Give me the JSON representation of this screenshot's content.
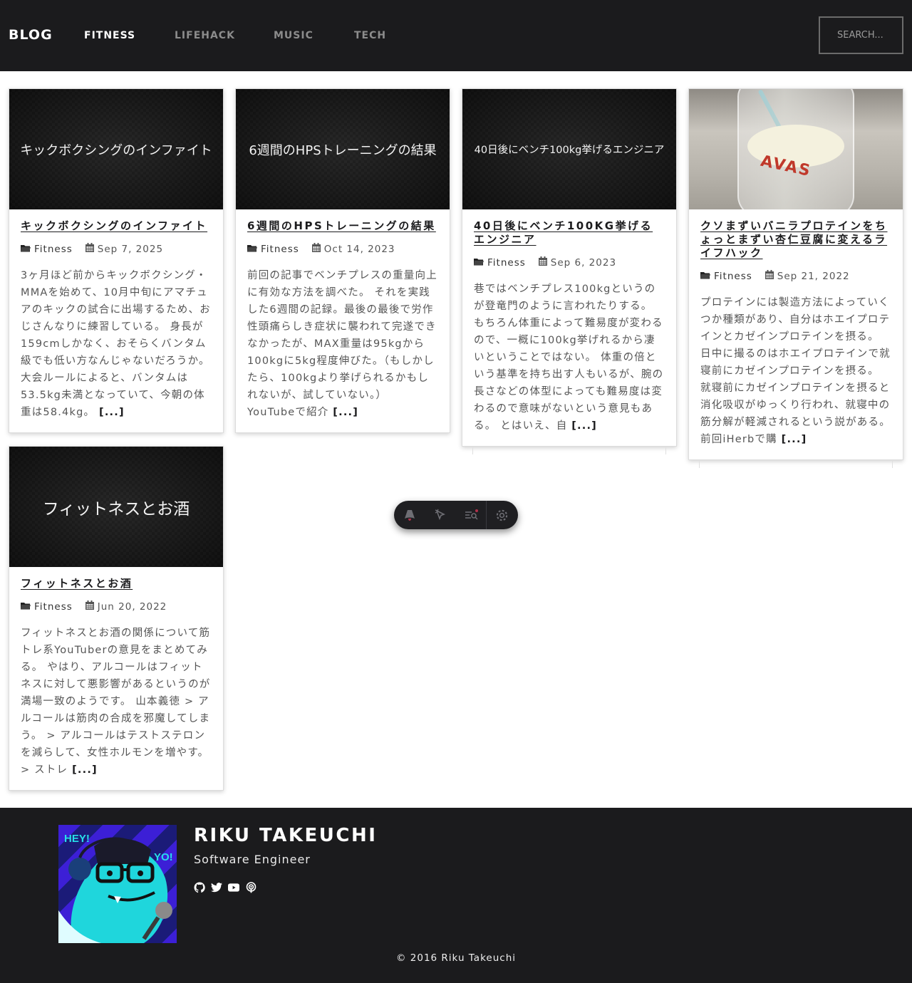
{
  "nav": {
    "brand": "BLOG",
    "links": [
      "FITNESS",
      "LIFEHACK",
      "MUSIC",
      "TECH"
    ],
    "search_placeholder": "SEARCH..."
  },
  "posts": [
    {
      "thumb_text": "キックボクシングのインファイト",
      "title": "キックボクシングのインファイト",
      "category": "Fitness",
      "date": "Sep 7, 2025",
      "excerpt": "3ヶ月ほど前からキックボクシング・MMAを始めて、10月中旬にアマチュアのキックの試合に出場するため、おじさんなりに練習している。 身長が159cmしかなく、おそらくバンタム級でも低い方なんじゃないだろうか。 大会ルールによると、バンタムは53.5kg未満となっていて、今朝の体重は58.4kg。",
      "more": "[...]"
    },
    {
      "thumb_text": "6週間のHPSトレーニングの結果",
      "title": "6週間のHPSトレーニングの結果",
      "category": "Fitness",
      "date": "Oct 14, 2023",
      "excerpt": "前回の記事でベンチプレスの重量向上に有効な方法を調べた。 それを実践した6週間の記録。最後の最後で労作性頭痛らしき症状に襲われて完遂できなかったが、MAX重量は95kgから100kgに5kg程度伸びた。（もしかしたら、100kgより挙げられるかもしれないが、試していない。） YouTubeで紹介",
      "more": "[...]"
    },
    {
      "thumb_text": "40日後にベンチ100kg挙げるエンジニア",
      "title": "40日後にベンチ100KG挙げるエンジニア",
      "category": "Fitness",
      "date": "Sep 6, 2023",
      "excerpt": "巷ではベンチプレス100kgというのが登竜門のように言われたりする。 もちろん体重によって難易度が変わるので、一概に100kg挙げれるから凄いということではない。 体重の倍という基準を持ち出す人もいるが、腕の長さなどの体型によっても難易度は変わるので意味がないという意見もある。 とはいえ、自",
      "more": "[...]"
    },
    {
      "thumb_text": "",
      "photo_caption": "AVAS",
      "title": "クソまずいバニラプロテインをちょっとまずい杏仁豆腐に変えるライフハック",
      "category": "Fitness",
      "date": "Sep 21, 2022",
      "excerpt": "プロテインには製造方法によっていくつか種類があり、自分はホエイプロテインとカゼインプロテインを摂る。 日中に撮るのはホエイプロテインで就寝前にカゼインプロテインを摂る。 就寝前にカゼインプロテインを摂ると消化吸収がゆっくり行われ、就寝中の筋分解が軽減されるという説がある。 前回iHerbで購",
      "more": "[...]"
    },
    {
      "thumb_text": "フィットネスとお酒",
      "title": "フィットネスとお酒",
      "category": "Fitness",
      "date": "Jun 20, 2022",
      "excerpt": "フィットネスとお酒の関係について筋トレ系YouTuberの意見をまとめてみる。 やはり、アルコールはフィットネスに対して悪影響があるというのが満場一致のようです。 山本義徳 > アルコールは筋肉の合成を邪魔してしまう。 > アルコールはテストステロンを減らして、女性ホルモンを増やす。 > ストレ",
      "more": "[...]"
    }
  ],
  "toolbar": {
    "icons": [
      "astro-logo-icon",
      "cursor-inspect-icon",
      "audit-list-icon",
      "settings-gear-icon"
    ]
  },
  "footer": {
    "avatar_text_left": "HEY!",
    "avatar_text_right": "YO!",
    "name": "RIKU TAKEUCHI",
    "role": "Software Engineer",
    "social_icons": [
      "github-icon",
      "twitter-icon",
      "youtube-icon",
      "podcast-icon"
    ],
    "copyright": "© 2016 Riku Takeuchi"
  },
  "colors": {
    "nav_bg": "#1b1b1d",
    "footer_bg": "#1b1b1d",
    "accent_text": "#1b1b1d"
  }
}
